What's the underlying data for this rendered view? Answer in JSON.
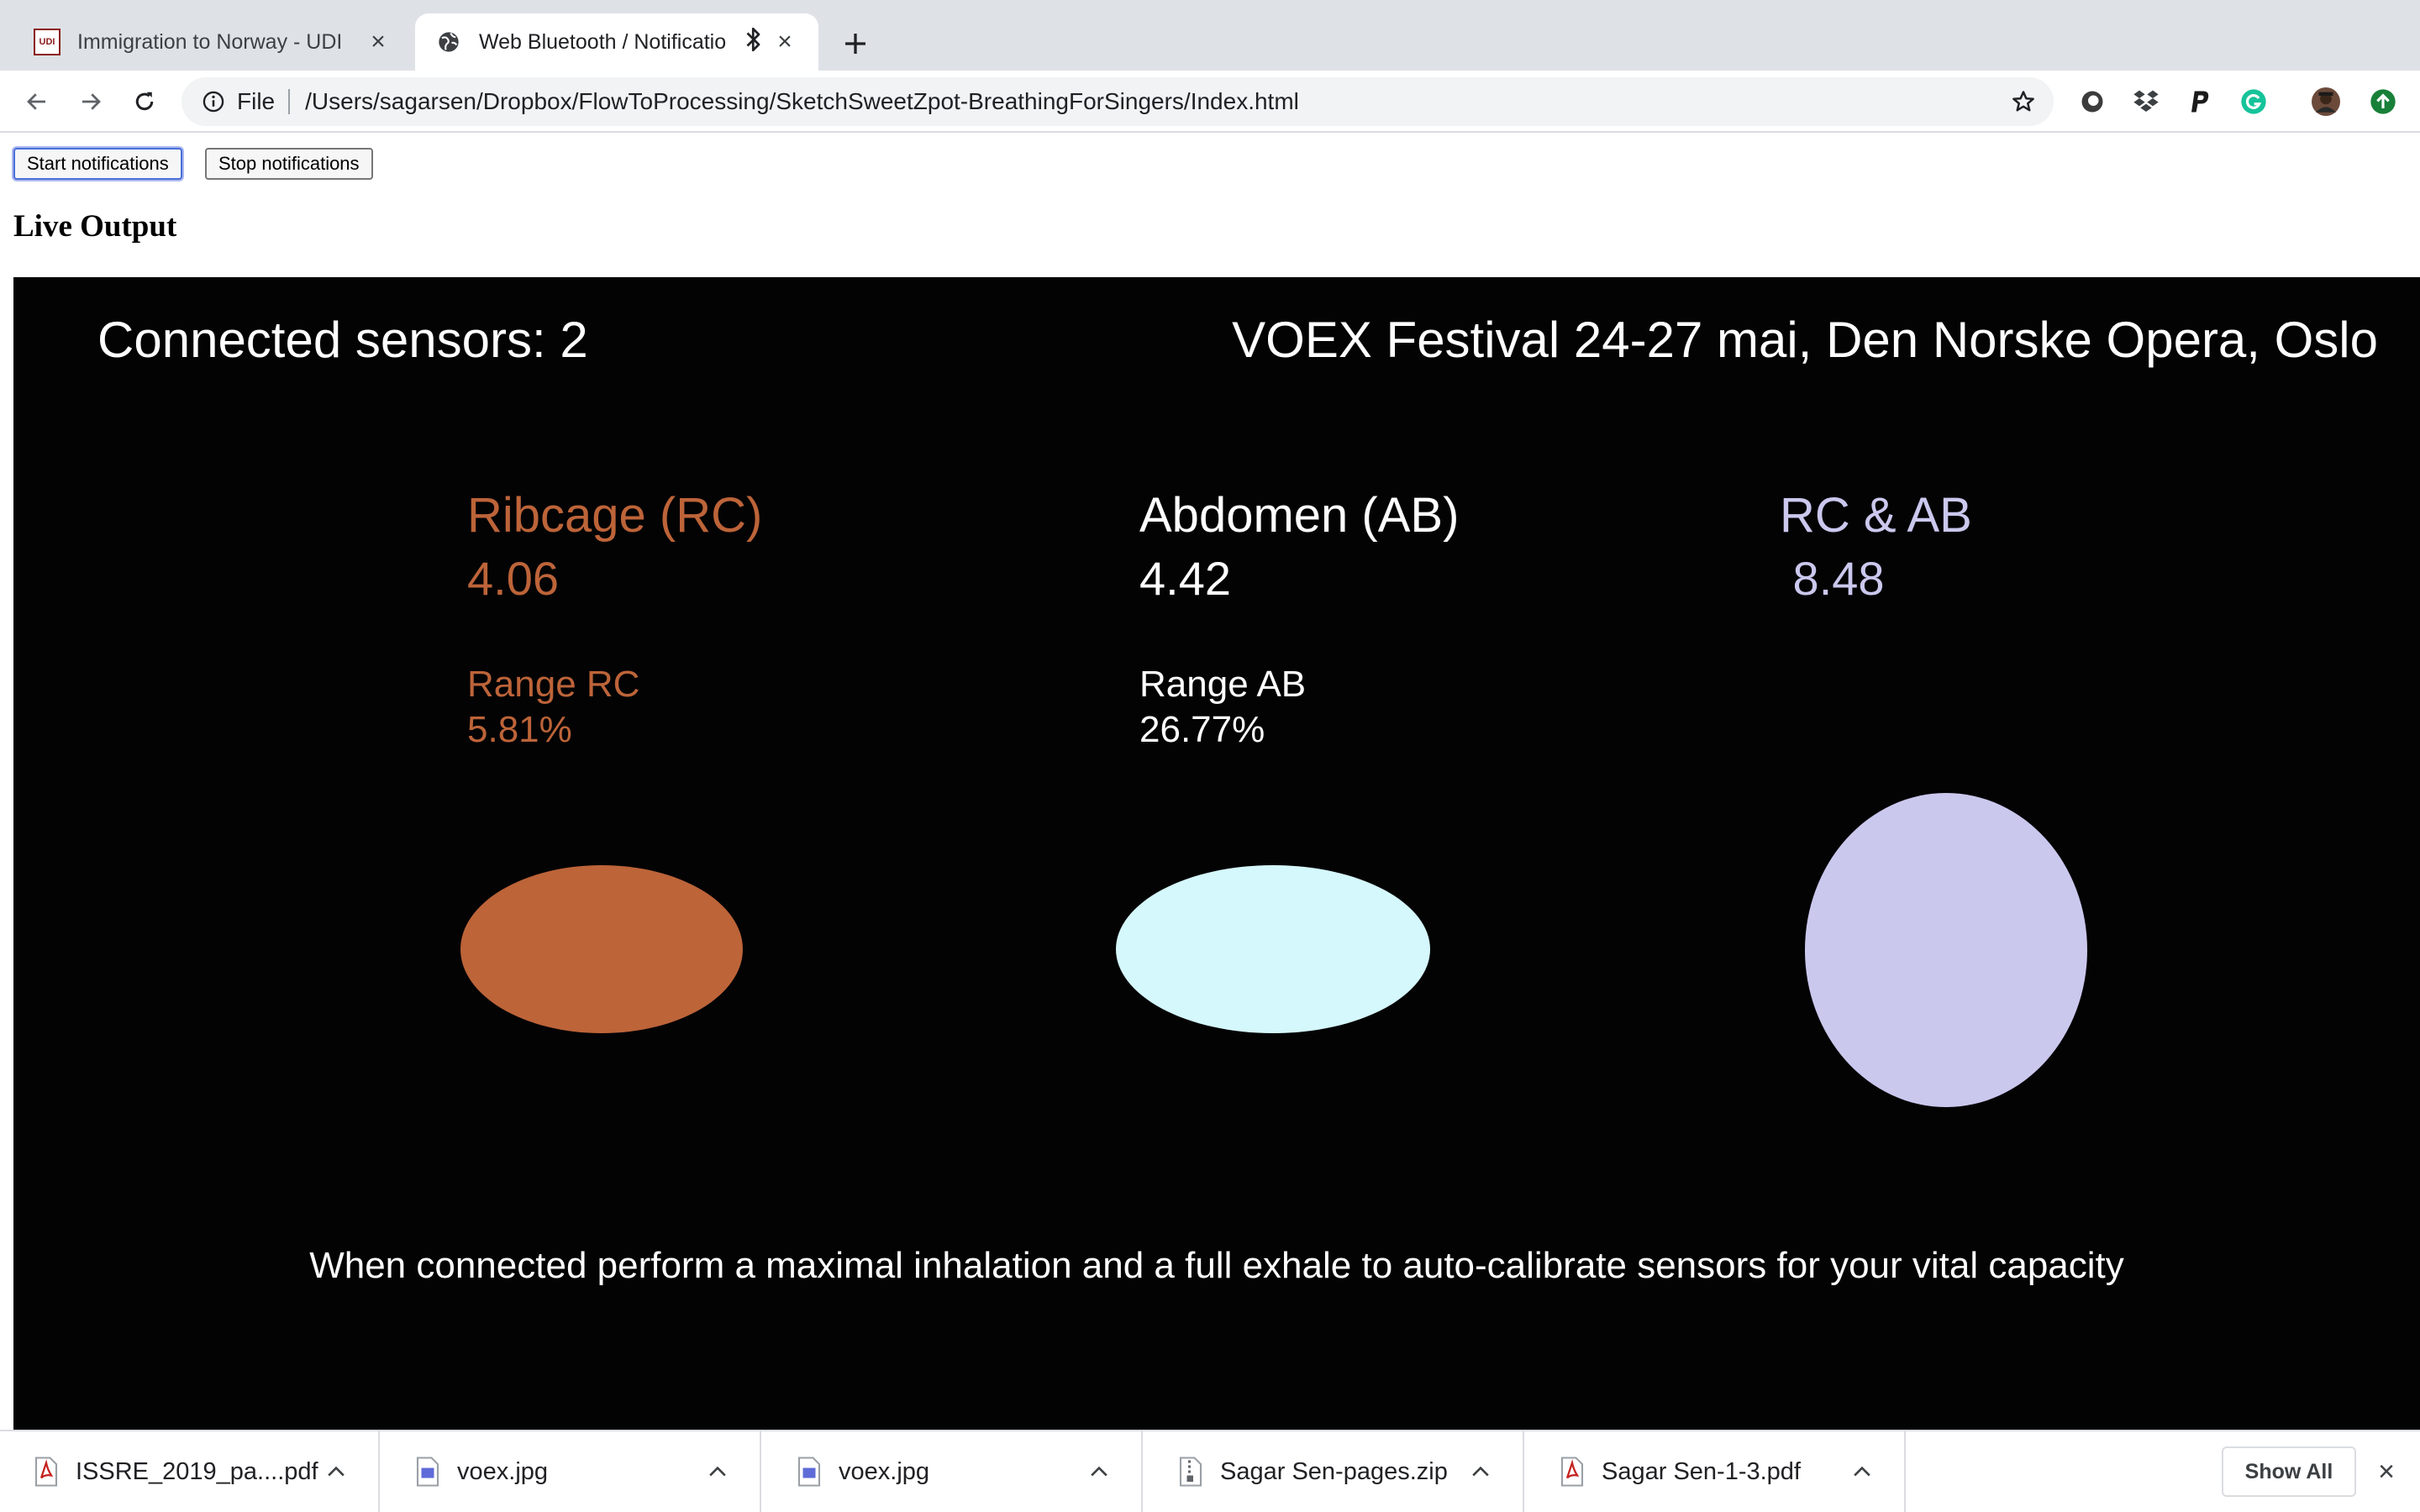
{
  "browser": {
    "tabs": [
      {
        "title": "Immigration to Norway - UDI",
        "favicon": "udi-logo",
        "favicon_text": "UDI"
      },
      {
        "title": "Web Bluetooth / Notificatio",
        "favicon": "globe-icon",
        "indicator": "bluetooth-icon"
      }
    ],
    "address_bar": {
      "scheme_label": "File",
      "url": "/Users/sagarsen/Dropbox/FlowToProcessing/SketchSweetZpot-BreathingForSingers/Index.html"
    }
  },
  "page": {
    "start_button": "Start notifications",
    "stop_button": "Stop notifications",
    "heading": "Live Output"
  },
  "canvas": {
    "background": "#030304",
    "connected": "Connected sensors: 2",
    "festival": "VOEX Festival 24-27 mai, Den Norske Opera, Oslo",
    "ribcage": {
      "label": "Ribcage (RC)",
      "value": "4.06",
      "range_label": "Range RC",
      "range_value": "5.81%",
      "color": "#bd6439"
    },
    "abdomen": {
      "label": "Abdomen (AB)",
      "value": "4.42",
      "range_label": "Range AB",
      "range_value": "26.77%",
      "color": "#d5f8fc"
    },
    "combined": {
      "label": "RC & AB",
      "value": " 8.48",
      "color": "#cbc8ee"
    },
    "instruction": "When connected perform a maximal inhalation and a full exhale to auto-calibrate sensors for your vital capacity"
  },
  "downloads": {
    "items": [
      {
        "name": "ISSRE_2019_pa....pdf",
        "icon": "pdf-file-icon"
      },
      {
        "name": "voex.jpg",
        "icon": "jpg-file-icon"
      },
      {
        "name": "voex.jpg",
        "icon": "jpg-file-icon"
      },
      {
        "name": "Sagar Sen-pages.zip",
        "icon": "zip-file-icon"
      },
      {
        "name": "Sagar Sen-1-3.pdf",
        "icon": "pdf-file-icon"
      }
    ],
    "show_all": "Show All"
  }
}
